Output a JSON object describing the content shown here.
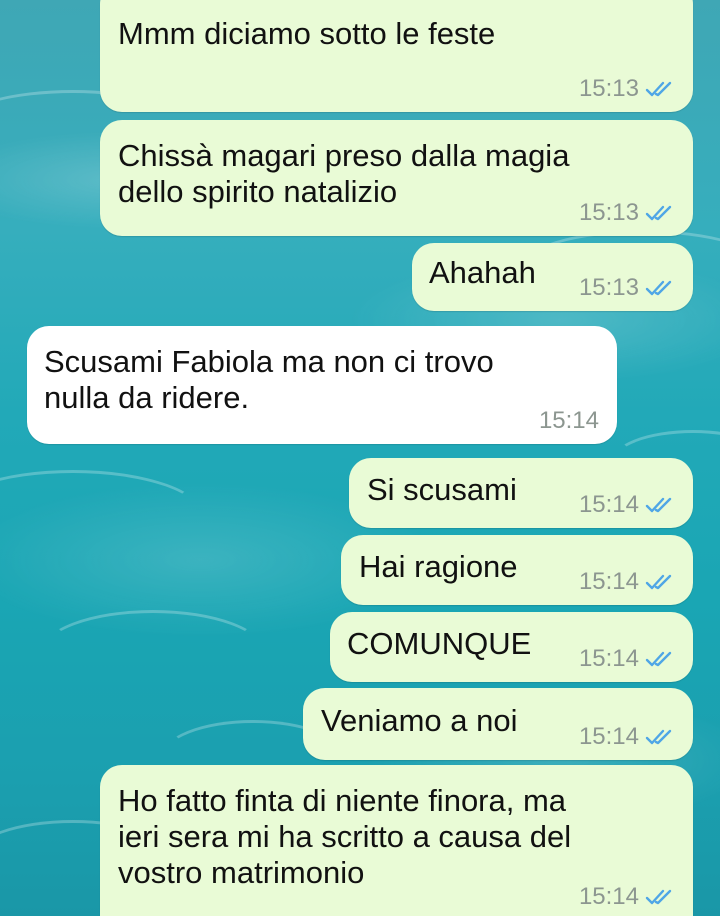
{
  "chat": {
    "messages": [
      {
        "direction": "out",
        "text": "Mmm diciamo sotto le feste",
        "time": "15:13",
        "status": "read-double-check-icon"
      },
      {
        "direction": "out",
        "text": "Chissà magari preso dalla magia\ndello spirito natalizio",
        "time": "15:13",
        "status": "read-double-check-icon"
      },
      {
        "direction": "out",
        "text": "Ahahah",
        "time": "15:13",
        "status": "read-double-check-icon"
      },
      {
        "direction": "in",
        "text": "Scusami Fabiola ma non ci trovo\nnulla da ridere.",
        "time": "15:14"
      },
      {
        "direction": "out",
        "text": "Si scusami",
        "time": "15:14",
        "status": "read-double-check-icon"
      },
      {
        "direction": "out",
        "text": "Hai ragione",
        "time": "15:14",
        "status": "read-double-check-icon"
      },
      {
        "direction": "out",
        "text": "COMUNQUE",
        "time": "15:14",
        "status": "read-double-check-icon"
      },
      {
        "direction": "out",
        "text": "Veniamo a noi",
        "time": "15:14",
        "status": "read-double-check-icon"
      },
      {
        "direction": "out",
        "text": "Ho fatto finta di niente finora, ma\nieri sera mi ha scritto a causa del\nvostro matrimonio",
        "time": "15:14",
        "status": "read-double-check-icon"
      }
    ]
  },
  "colors": {
    "outgoing_bubble": "#e9fbd6",
    "incoming_bubble": "#ffffff",
    "read_ticks": "#4fa6e6",
    "timestamp": "#8c9690"
  }
}
